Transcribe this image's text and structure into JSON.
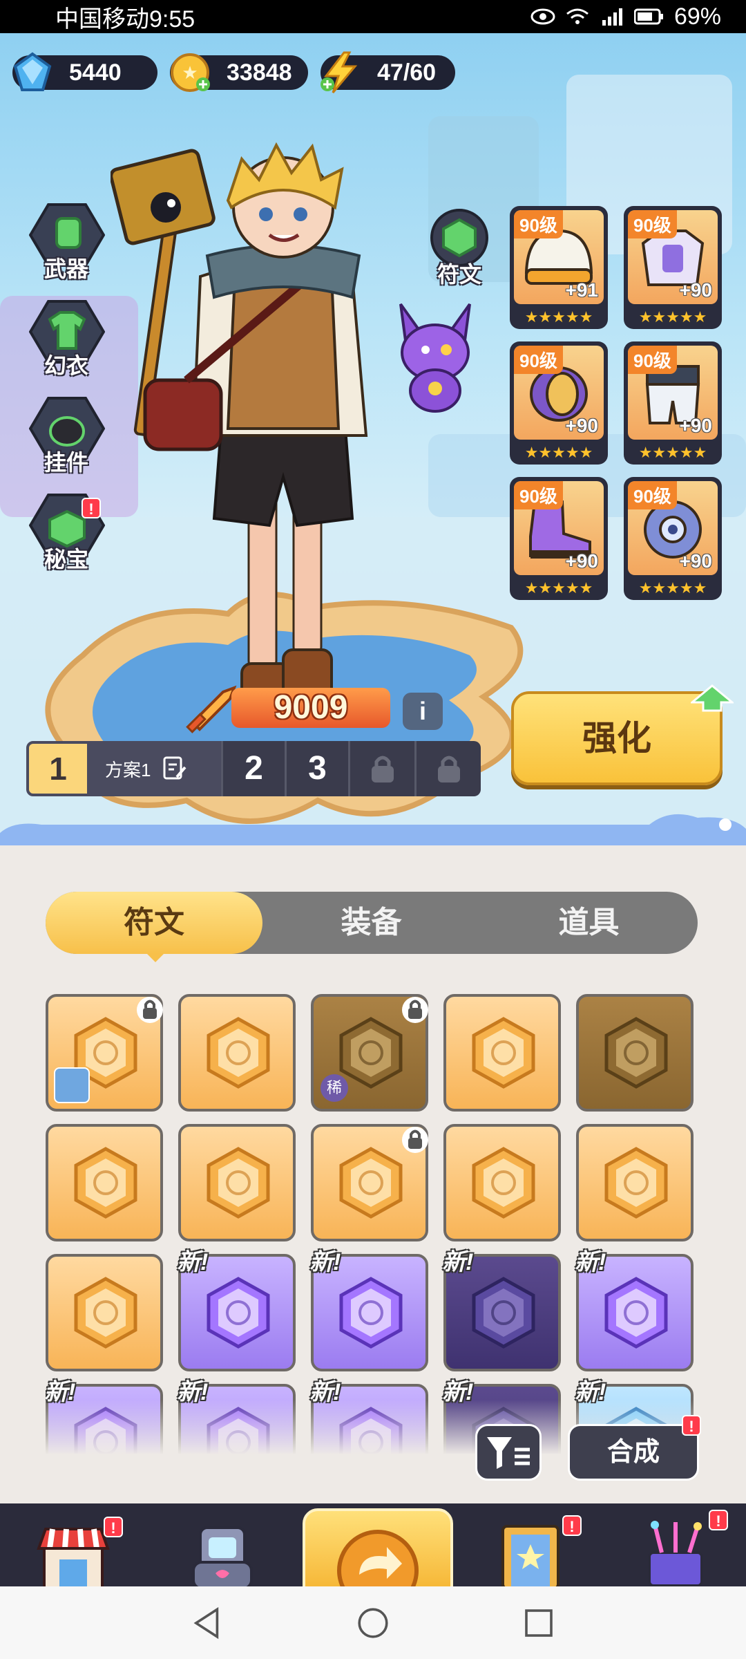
{
  "status_bar": {
    "carrier_time": "中国移动9:55",
    "battery": "69%"
  },
  "currency": {
    "gems": "5440",
    "coins": "33848",
    "energy": "47/60"
  },
  "side_menu": [
    {
      "label": "武器",
      "icon": "weapon-icon"
    },
    {
      "label": "幻衣",
      "icon": "outfit-icon"
    },
    {
      "label": "挂件",
      "icon": "pendant-icon"
    },
    {
      "label": "秘宝",
      "icon": "treasure-icon",
      "badge": "!"
    }
  ],
  "rune_button": {
    "label": "符文"
  },
  "equipment": [
    {
      "level": "90级",
      "plus": "+91",
      "stars": "★★★★★",
      "item": "helmet"
    },
    {
      "level": "90级",
      "plus": "+90",
      "stars": "★★★★★",
      "item": "armor"
    },
    {
      "level": "90级",
      "plus": "+90",
      "stars": "★★★★★",
      "item": "bracer"
    },
    {
      "level": "90级",
      "plus": "+90",
      "stars": "★★★★★",
      "item": "pants"
    },
    {
      "level": "90级",
      "plus": "+90",
      "stars": "★★★★★",
      "item": "boots"
    },
    {
      "level": "90级",
      "plus": "+90",
      "stars": "★★★★★",
      "item": "accessory"
    }
  ],
  "power": {
    "value": "9009",
    "info": "i"
  },
  "plans": {
    "active": "1",
    "name": "方案1",
    "others": [
      "2",
      "3"
    ]
  },
  "upgrade": {
    "label": "强化"
  },
  "tabs": [
    {
      "label": "符文",
      "active": true
    },
    {
      "label": "装备",
      "active": false
    },
    {
      "label": "道具",
      "active": false
    }
  ],
  "inventory": [
    {
      "style": "gold",
      "lock": true,
      "tag": "char"
    },
    {
      "style": "gold"
    },
    {
      "style": "dark",
      "lock": true,
      "tag": "rare",
      "tag_text": "稀"
    },
    {
      "style": "gold"
    },
    {
      "style": "dark"
    },
    {
      "style": "gold"
    },
    {
      "style": "gold"
    },
    {
      "style": "gold",
      "lock": true
    },
    {
      "style": "gold"
    },
    {
      "style": "gold"
    },
    {
      "style": "gold"
    },
    {
      "style": "purple",
      "new": "新!"
    },
    {
      "style": "purple",
      "new": "新!"
    },
    {
      "style": "purple-dark",
      "new": "新!"
    },
    {
      "style": "purple",
      "new": "新!"
    },
    {
      "style": "purple",
      "new": "新!"
    },
    {
      "style": "purple",
      "new": "新!"
    },
    {
      "style": "purple",
      "new": "新!"
    },
    {
      "style": "purple-dark",
      "new": "新!"
    },
    {
      "style": "blue",
      "new": "新!"
    }
  ],
  "actions": {
    "craft": "合成",
    "craft_badge": "!"
  },
  "bottom_nav": [
    {
      "name": "shop",
      "badge": "!"
    },
    {
      "name": "gacha-machine"
    },
    {
      "name": "back-return"
    },
    {
      "name": "card-frame",
      "badge": "!"
    },
    {
      "name": "event-gift",
      "badge": "!"
    }
  ],
  "colors": {
    "accent": "#f9c23a",
    "panel": "#eeeae6",
    "dark_ui": "#3e3f4e"
  }
}
